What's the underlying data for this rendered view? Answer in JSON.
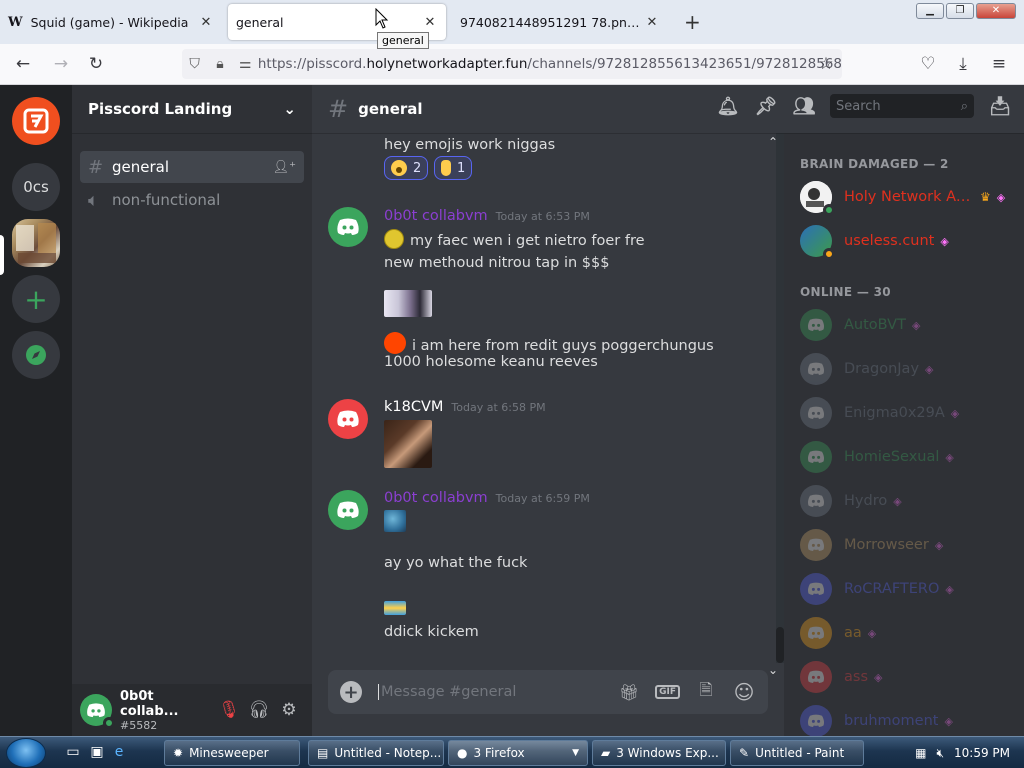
{
  "browser": {
    "tabs": [
      {
        "title": "Squid (game) - Wikipedia",
        "favicon": "W"
      },
      {
        "title": "general"
      },
      {
        "title": "9740821448951291 78.png (JPEG Ima"
      }
    ],
    "tooltip": "general",
    "url_prefix": "https://pisscord.",
    "url_domain": "holynetworkadapter.fun",
    "url_path": "/channels/972812855613423651/9728128568"
  },
  "server": {
    "name": "Pisscord Landing",
    "guild_ocs_label": "0cs"
  },
  "channels": [
    {
      "name": "general",
      "icon": "hash-icon"
    },
    {
      "name": "non-functional",
      "icon": "speaker-icon"
    }
  ],
  "user": {
    "name": "0b0t collab...",
    "tag": "#5582"
  },
  "chat": {
    "channel_name": "general",
    "search_placeholder": "Search",
    "composer_placeholder": "Message #general"
  },
  "messages": {
    "m0_text": "hey emojis work niggas",
    "m0_r1_count": "2",
    "m0_r2_count": "1",
    "g1_author": "0b0t collabvm",
    "g1_time": "Today at 6:53 PM",
    "g1_l1": "my faec wen i get nietro foer fre",
    "g1_l2": "new methoud nitrou tap in $$$",
    "g1_l3": "i am here from redit guys poggerchungus",
    "g1_l4": "1000 holesome keanu reeves",
    "g2_author": "k18CVM",
    "g2_time": "Today at 6:58 PM",
    "g3_author": "0b0t collabvm",
    "g3_time": "Today at 6:59 PM",
    "g3_l1": "ay yo what the fuck",
    "g3_l2": "ddick kickem"
  },
  "members": {
    "section_brain": "BRAIN DAMAGED — 2",
    "brain": [
      {
        "name": "Holy Network Ad...",
        "color": "#e0301e",
        "owner": true
      },
      {
        "name": "useless.cunt",
        "color": "#e0301e"
      }
    ],
    "section_online": "ONLINE — 30",
    "online": [
      {
        "name": "AutoBVT",
        "avatar": "#3ba55d"
      },
      {
        "name": "DragonJay",
        "avatar": "#747f8d"
      },
      {
        "name": "Enigma0x29A",
        "avatar": "#747f8d"
      },
      {
        "name": "HomieSexual",
        "avatar": "#3ba55d"
      },
      {
        "name": "Hydro",
        "avatar": "#747f8d"
      },
      {
        "name": "Morrowseer",
        "avatar": "#c9a46a"
      },
      {
        "name": "RoCRAFTERO",
        "avatar": "#5865f2"
      },
      {
        "name": "aa",
        "avatar": "#faa61a"
      },
      {
        "name": "ass",
        "avatar": "#ed4245"
      },
      {
        "name": "bruhmoment",
        "avatar": "#5865f2"
      }
    ]
  },
  "taskbar": {
    "tasks": [
      {
        "label": "Minesweeper",
        "icon": "minesweeper-icon"
      },
      {
        "label": "Untitled - Notep...",
        "icon": "notepad-icon"
      },
      {
        "label": "3 Firefox",
        "icon": "firefox-icon"
      },
      {
        "label": "3 Windows Exp...",
        "icon": "folder-icon"
      },
      {
        "label": "Untitled - Paint",
        "icon": "paint-icon"
      }
    ],
    "clock": "10:59 PM"
  },
  "colors": {
    "accent": "#5865f2",
    "online": "#3ba55d",
    "collab_name": "#8b3fd1",
    "brain_name": "#e0301e"
  }
}
